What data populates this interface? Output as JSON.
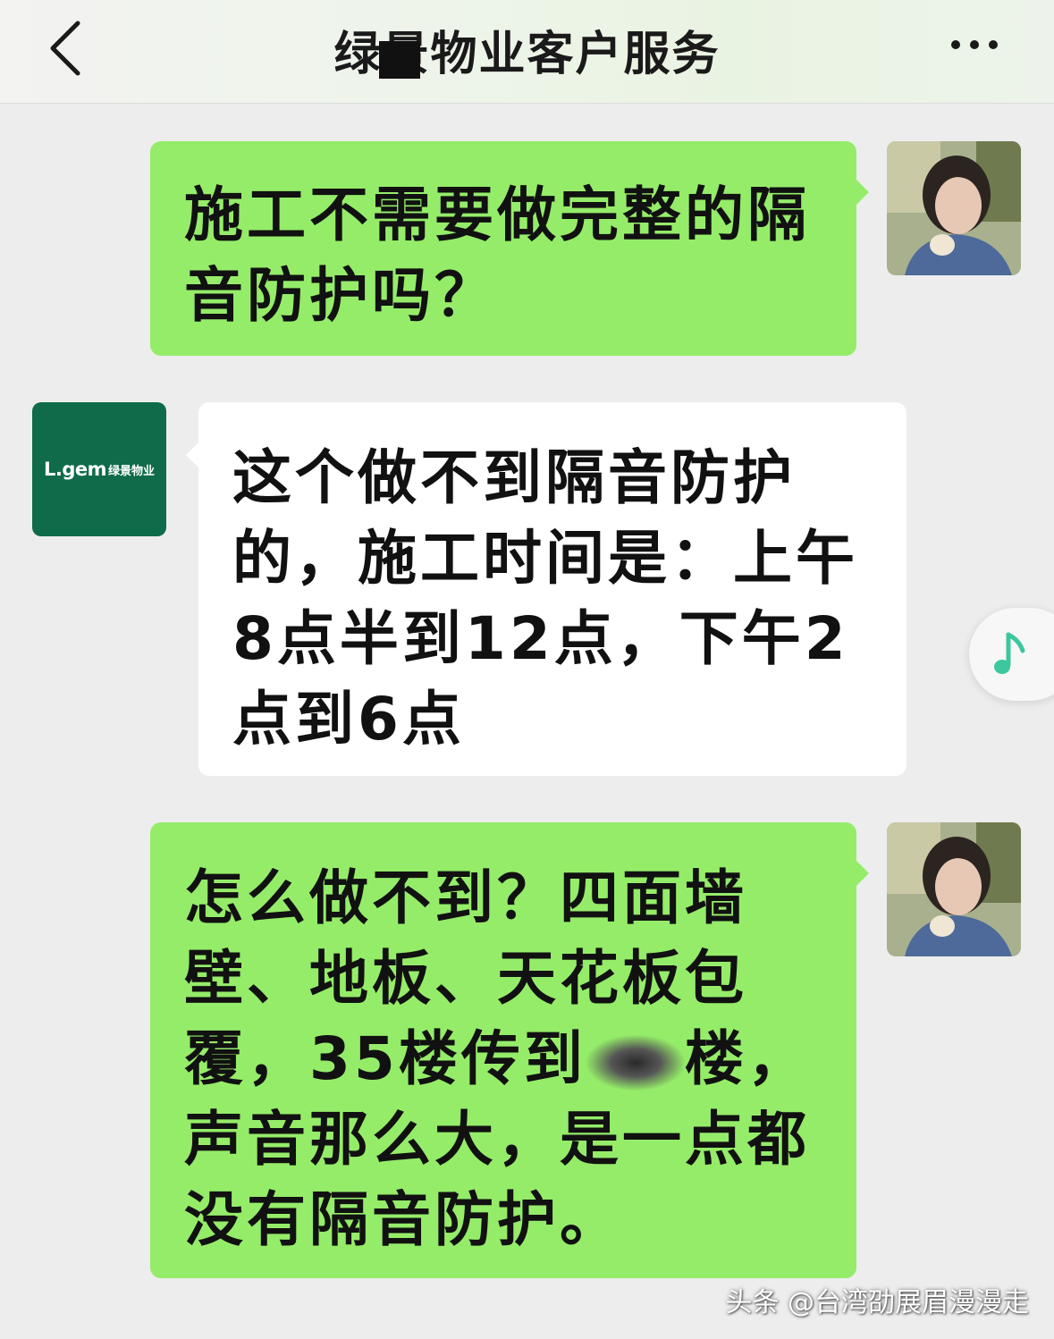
{
  "header": {
    "title": "绿景物业客户服务",
    "back_icon": "chevron-left-icon",
    "more_icon": "ellipsis-icon"
  },
  "messages": [
    {
      "sender": "self",
      "lines": [
        "施工不需要做完整的隔",
        "音防护吗？"
      ]
    },
    {
      "sender": "enterprise",
      "avatar_text": "L.gem",
      "avatar_sub": "绿景物业",
      "lines": [
        "这个做不到隔音防护",
        "的，施工时间是：上午",
        "8点半到12点，下午2",
        "点到6点"
      ]
    },
    {
      "sender": "self",
      "lines": [
        "怎么做不到？四面墙",
        "壁、地板、天花板包",
        "覆，35楼传到",
        "楼，",
        "声音那么大，是一点都",
        "没有隔音防护。"
      ]
    }
  ],
  "floating": {
    "music_icon": "music-note-icon"
  },
  "watermark": "头条 @台湾劭展眉漫漫走",
  "colors": {
    "self_bubble": "#95ec69",
    "other_bubble": "#ffffff",
    "background": "#ededed",
    "brand": "#0f6b4a",
    "music_icon": "#3cc79e"
  }
}
